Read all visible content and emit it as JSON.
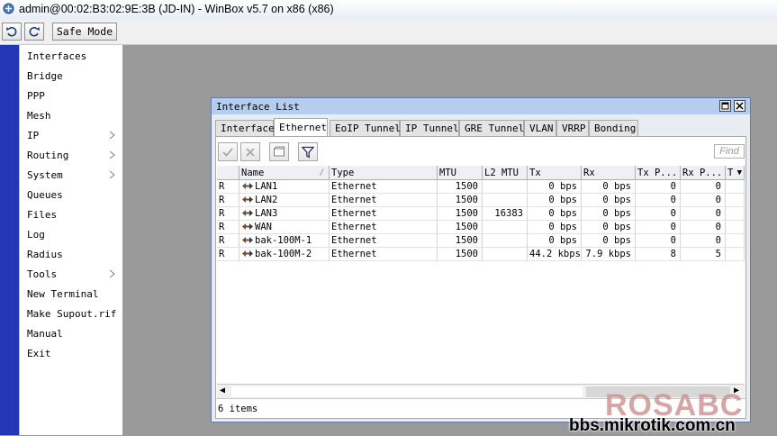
{
  "app": {
    "title": "admin@00:02:B3:02:9E:3B (JD-IN) - WinBox v5.7 on x86 (x86)"
  },
  "toolbar": {
    "undo_icon": "undo-icon",
    "redo_icon": "redo-icon",
    "safe_mode_label": "Safe Mode"
  },
  "menu": {
    "items": [
      {
        "label": "Interfaces",
        "has_submenu": false
      },
      {
        "label": "Bridge",
        "has_submenu": false
      },
      {
        "label": "PPP",
        "has_submenu": false
      },
      {
        "label": "Mesh",
        "has_submenu": false
      },
      {
        "label": "IP",
        "has_submenu": true
      },
      {
        "label": "Routing",
        "has_submenu": true
      },
      {
        "label": "System",
        "has_submenu": true
      },
      {
        "label": "Queues",
        "has_submenu": false
      },
      {
        "label": "Files",
        "has_submenu": false
      },
      {
        "label": "Log",
        "has_submenu": false
      },
      {
        "label": "Radius",
        "has_submenu": false
      },
      {
        "label": "Tools",
        "has_submenu": true
      },
      {
        "label": "New Terminal",
        "has_submenu": false
      },
      {
        "label": "Make Supout.rif",
        "has_submenu": false
      },
      {
        "label": "Manual",
        "has_submenu": false
      },
      {
        "label": "Exit",
        "has_submenu": false
      }
    ]
  },
  "window": {
    "title": "Interface List",
    "tabs": [
      "Interface",
      "Ethernet",
      "EoIP Tunnel",
      "IP Tunnel",
      "GRE Tunnel",
      "VLAN",
      "VRRP",
      "Bonding"
    ],
    "active_tab": "Ethernet",
    "find_placeholder": "Find",
    "columns": [
      "",
      "Name",
      "Type",
      "MTU",
      "L2 MTU",
      "Tx",
      "Rx",
      "Tx P...",
      "Rx P...",
      "T"
    ],
    "rows": [
      {
        "flag": "R",
        "name": "LAN1",
        "type": "Ethernet",
        "mtu": "1500",
        "l2mtu": "",
        "tx": "0 bps",
        "rx": "0 bps",
        "txp": "0",
        "rxp": "0"
      },
      {
        "flag": "R",
        "name": "LAN2",
        "type": "Ethernet",
        "mtu": "1500",
        "l2mtu": "",
        "tx": "0 bps",
        "rx": "0 bps",
        "txp": "0",
        "rxp": "0"
      },
      {
        "flag": "R",
        "name": "LAN3",
        "type": "Ethernet",
        "mtu": "1500",
        "l2mtu": "16383",
        "tx": "0 bps",
        "rx": "0 bps",
        "txp": "0",
        "rxp": "0"
      },
      {
        "flag": "R",
        "name": "WAN",
        "type": "Ethernet",
        "mtu": "1500",
        "l2mtu": "",
        "tx": "0 bps",
        "rx": "0 bps",
        "txp": "0",
        "rxp": "0"
      },
      {
        "flag": "R",
        "name": "bak-100M-1",
        "type": "Ethernet",
        "mtu": "1500",
        "l2mtu": "",
        "tx": "0 bps",
        "rx": "0 bps",
        "txp": "0",
        "rxp": "0"
      },
      {
        "flag": "R",
        "name": "bak-100M-2",
        "type": "Ethernet",
        "mtu": "1500",
        "l2mtu": "",
        "tx": "44.2 kbps",
        "rx": "7.9 kbps",
        "txp": "8",
        "rxp": "5"
      }
    ],
    "status": "6 items"
  },
  "watermark": {
    "brand": "ROSABC",
    "site": "bbs.mikrotik.com.cn"
  },
  "colors": {
    "sidebar_strip": "#2236b6",
    "window_title": "#b5cef0",
    "desktop": "#9a9a9a"
  }
}
